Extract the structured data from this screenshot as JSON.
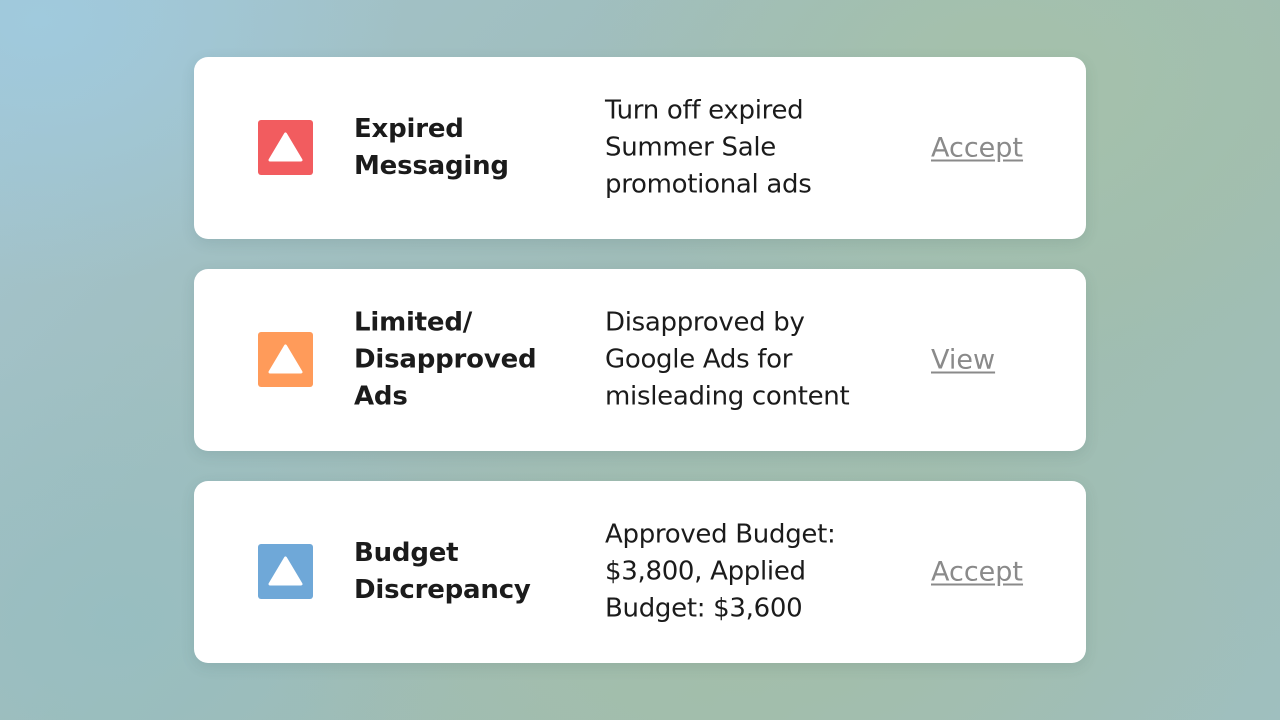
{
  "alerts": [
    {
      "title": "Expired\nMessaging",
      "description": "Turn off expired\nSummer Sale\npromotional ads",
      "action": "Accept",
      "icon": "warning-triangle-icon",
      "icon_color": "#f25c5f"
    },
    {
      "title": "Limited/\nDisapproved\nAds",
      "description": "Disapproved by\nGoogle Ads for\nmisleading content",
      "action": "View",
      "icon": "warning-triangle-icon",
      "icon_color": "#ff9b5a"
    },
    {
      "title": "Budget\nDiscrepancy",
      "description": "Approved Budget:\n$3,800, Applied\nBudget: $3,600",
      "action": "Accept",
      "icon": "warning-triangle-icon",
      "icon_color": "#6fa8d8"
    }
  ]
}
